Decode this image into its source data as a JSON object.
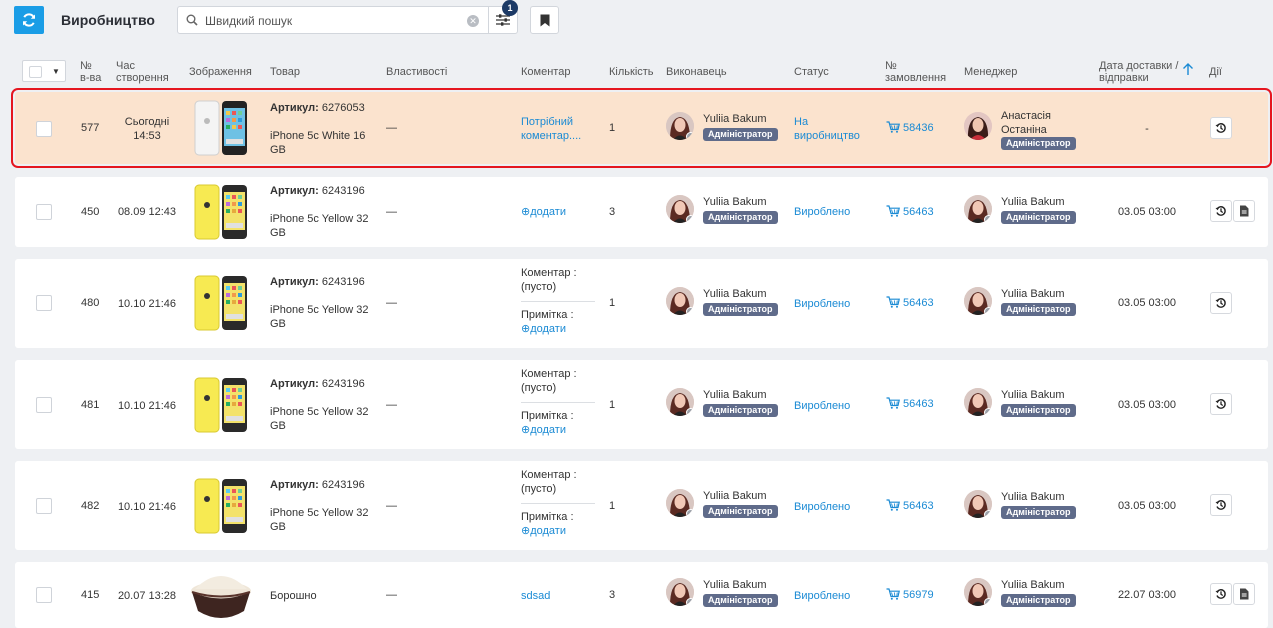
{
  "header": {
    "title": "Виробництво",
    "search_placeholder": "Швидкий пошук",
    "filter_badge": "1"
  },
  "columns": {
    "num": "№ в-ва",
    "created": "Час створення",
    "image": "Зображення",
    "product": "Товар",
    "props": "Властивості",
    "comment": "Коментар",
    "qty": "Кількість",
    "performer": "Виконавець",
    "status": "Статус",
    "order": "№ замовлення",
    "manager": "Менеджер",
    "delivery": "Дата доставки / відправки",
    "actions": "Дії"
  },
  "labels": {
    "article": "Артикул:",
    "comment_label": "Коментар :",
    "empty": "(пусто)",
    "note_label": "Примітка :",
    "add": "⊕додати"
  },
  "rows": [
    {
      "num": "577",
      "created": "Сьогодні 14:53",
      "article": "6276053",
      "product": "iPhone 5c White 16 GB",
      "props": "—",
      "comment": "Потрібний коментар....",
      "qty": "1",
      "performer": "Yuliia Bakum",
      "performer_role": "Адміністратор",
      "status": "На виробництво",
      "order": "58436",
      "manager": "Анастасія Останіна",
      "manager_role": "Адміністратор",
      "delivery": "-",
      "image": "iphone-white"
    },
    {
      "num": "450",
      "created": "08.09 12:43",
      "article": "6243196",
      "product": "iPhone 5c Yellow 32 GB",
      "props": "—",
      "comment": "⊕додати",
      "qty": "3",
      "performer": "Yuliia Bakum",
      "performer_role": "Адміністратор",
      "status": "Вироблено",
      "order": "56463",
      "manager": "Yuliia Bakum",
      "manager_role": "Адміністратор",
      "delivery": "03.05 03:00",
      "image": "iphone-yellow"
    },
    {
      "num": "480",
      "created": "10.10 21:46",
      "article": "6243196",
      "product": "iPhone 5c Yellow 32 GB",
      "props": "—",
      "qty": "1",
      "performer": "Yuliia Bakum",
      "performer_role": "Адміністратор",
      "status": "Вироблено",
      "order": "56463",
      "manager": "Yuliia Bakum",
      "manager_role": "Адміністратор",
      "delivery": "03.05 03:00",
      "image": "iphone-yellow"
    },
    {
      "num": "481",
      "created": "10.10 21:46",
      "article": "6243196",
      "product": "iPhone 5c Yellow 32 GB",
      "props": "—",
      "qty": "1",
      "performer": "Yuliia Bakum",
      "performer_role": "Адміністратор",
      "status": "Вироблено",
      "order": "56463",
      "manager": "Yuliia Bakum",
      "manager_role": "Адміністратор",
      "delivery": "03.05 03:00",
      "image": "iphone-yellow"
    },
    {
      "num": "482",
      "created": "10.10 21:46",
      "article": "6243196",
      "product": "iPhone 5c Yellow 32 GB",
      "props": "—",
      "qty": "1",
      "performer": "Yuliia Bakum",
      "performer_role": "Адміністратор",
      "status": "Вироблено",
      "order": "56463",
      "manager": "Yuliia Bakum",
      "manager_role": "Адміністратор",
      "delivery": "03.05 03:00",
      "image": "iphone-yellow"
    },
    {
      "num": "415",
      "created": "20.07 13:28",
      "product": "Борошно",
      "props": "—",
      "comment": "sdsad",
      "qty": "3",
      "performer": "Yuliia Bakum",
      "performer_role": "Адміністратор",
      "status": "Вироблено",
      "order": "56979",
      "manager": "Yuliia Bakum",
      "manager_role": "Адміністратор",
      "delivery": "22.07 03:00",
      "image": "flour-bowl"
    }
  ],
  "colors": {
    "accent": "#1a9de6",
    "link": "#1a8ad4",
    "highlight": "#fbe3ce",
    "role_badge": "#5f6b8a"
  }
}
